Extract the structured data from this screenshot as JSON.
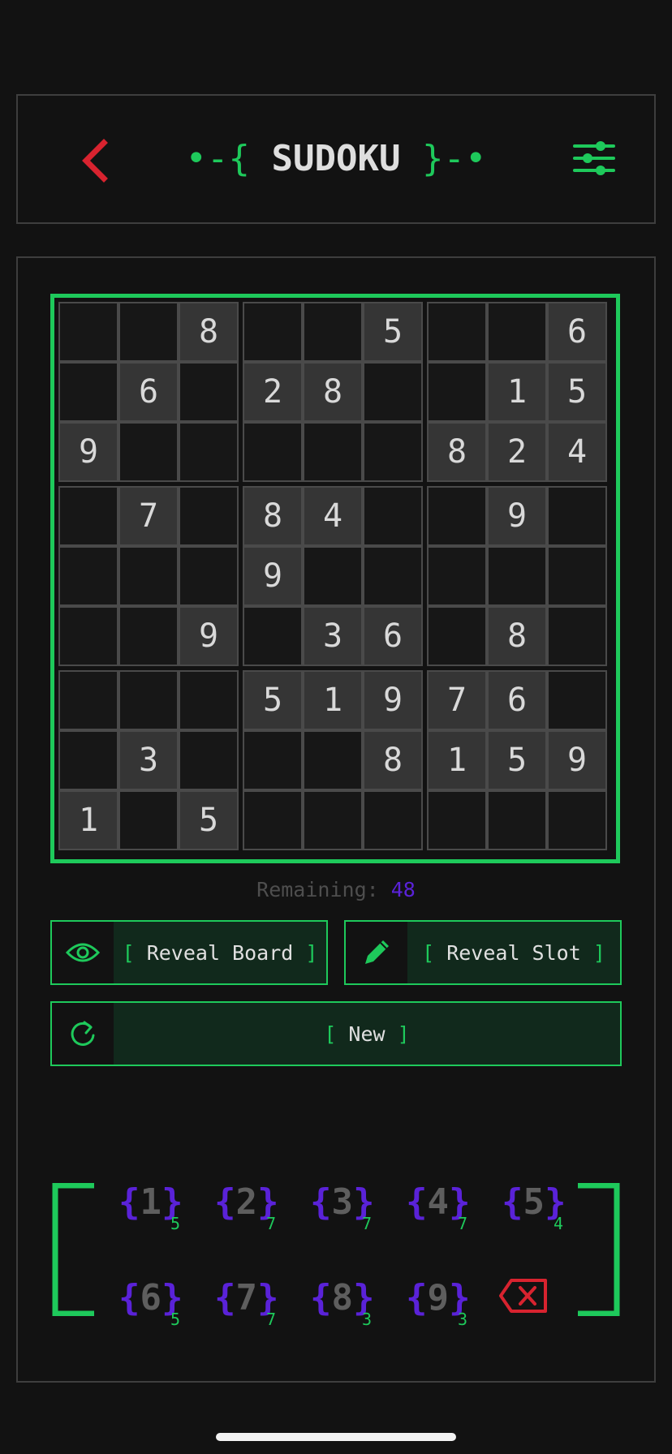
{
  "header": {
    "title_prefix": "•-{ ",
    "title": "SUDOKU",
    "title_suffix": " }-•",
    "back_icon": "chevron-left-icon",
    "settings_icon": "sliders-icon"
  },
  "colors": {
    "accent": "#1ec95b",
    "back": "#d8232f",
    "digit_brace": "#5a22d8",
    "given_cell": "#353535",
    "empty_cell": "#171717"
  },
  "board": [
    [
      0,
      0,
      8,
      0,
      0,
      5,
      0,
      0,
      6
    ],
    [
      0,
      6,
      0,
      2,
      8,
      0,
      0,
      1,
      5
    ],
    [
      9,
      0,
      0,
      0,
      0,
      0,
      8,
      2,
      4
    ],
    [
      0,
      7,
      0,
      8,
      4,
      0,
      0,
      9,
      0
    ],
    [
      0,
      0,
      0,
      9,
      0,
      0,
      0,
      0,
      0
    ],
    [
      0,
      0,
      9,
      0,
      3,
      6,
      0,
      8,
      0
    ],
    [
      0,
      0,
      0,
      5,
      1,
      9,
      7,
      6,
      0
    ],
    [
      0,
      3,
      0,
      0,
      0,
      8,
      1,
      5,
      9
    ],
    [
      1,
      0,
      5,
      0,
      0,
      0,
      0,
      0,
      0
    ]
  ],
  "status": {
    "remaining_label": "Remaining: ",
    "remaining_value": "48"
  },
  "actions": {
    "reveal_board": {
      "open": "[ ",
      "label": "Reveal Board",
      "close": " ]",
      "icon": "eye-icon"
    },
    "reveal_slot": {
      "open": "[ ",
      "label": "Reveal Slot",
      "close": " ]",
      "icon": "pencil-icon"
    },
    "new_game": {
      "open": "[ ",
      "label": "New",
      "close": " ]",
      "icon": "refresh-icon"
    }
  },
  "numpad": {
    "brace_open": "{",
    "brace_close": "}",
    "keys": [
      {
        "digit": "1",
        "count": "5"
      },
      {
        "digit": "2",
        "count": "7"
      },
      {
        "digit": "3",
        "count": "7"
      },
      {
        "digit": "4",
        "count": "7"
      },
      {
        "digit": "5",
        "count": "4"
      },
      {
        "digit": "6",
        "count": "5"
      },
      {
        "digit": "7",
        "count": "7"
      },
      {
        "digit": "8",
        "count": "3"
      },
      {
        "digit": "9",
        "count": "3"
      }
    ],
    "erase_icon": "backspace-icon"
  }
}
